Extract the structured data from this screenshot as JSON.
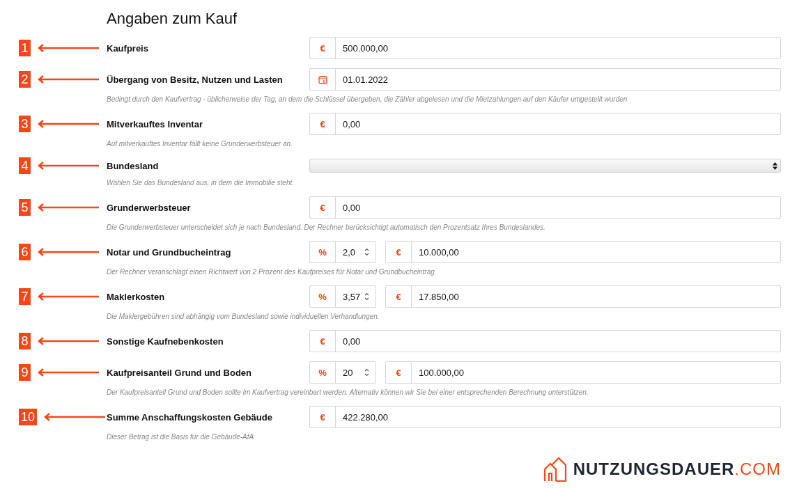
{
  "title": "Angaben zum Kauf",
  "rows": [
    {
      "number": "1",
      "label": "Kaufpreis",
      "kind": "money",
      "prefix": "€",
      "value": "500.000,00"
    },
    {
      "number": "2",
      "label": "Übergang von Besitz, Nutzen und Lasten",
      "kind": "date",
      "value": "01.01.2022",
      "hint": "Bedingt durch den Kaufvertrag - üblicherweise der Tag, an dem die Schlüssel übergeben, die Zähler abgelesen und die Mietzahlungen auf den Käufer umgestellt wurden"
    },
    {
      "number": "3",
      "label": "Mitverkauftes Inventar",
      "kind": "money",
      "prefix": "€",
      "value": "0,00",
      "hint": "Auf mitverkauftes Inventar fällt keine Grunderwerbsteuer an."
    },
    {
      "number": "4",
      "label": "Bundesland",
      "kind": "select",
      "hint": "Wählen Sie das Bundesland aus, in dem die Immobilie steht."
    },
    {
      "number": "5",
      "label": "Grunderwerbsteuer",
      "kind": "money",
      "prefix": "€",
      "value": "0,00",
      "hint": "Die Grunderwerbsteuer unterscheidet sich je nach Bundesland. Der Rechner berücksichtigt automatisch den Prozentsatz Ihres Bundeslandes."
    },
    {
      "number": "6",
      "label": "Notar und Grundbucheintrag",
      "kind": "split",
      "percent_prefix": "%",
      "percent": "2,0",
      "prefix": "€",
      "value": "10.000,00",
      "hint": "Der Rechner veranschlagt einen Richtwert von 2 Prozent des Kaufpreises für Notar und Grundbucheintrag"
    },
    {
      "number": "7",
      "label": "Maklerkosten",
      "kind": "split",
      "percent_prefix": "%",
      "percent": "3,57",
      "prefix": "€",
      "value": "17.850,00",
      "hint": "Die Maklergebühren sind abhängig vom Bundesland sowie individuellen Verhandlungen."
    },
    {
      "number": "8",
      "label": "Sonstige Kaufnebenkosten",
      "kind": "money",
      "prefix": "€",
      "value": "0,00"
    },
    {
      "number": "9",
      "label": "Kaufpreisanteil Grund und Boden",
      "kind": "split",
      "percent_prefix": "%",
      "percent": "20",
      "prefix": "€",
      "value": "100.000,00",
      "hint": "Der Kaufpreisanteil Grund und Boden sollte im Kaufvertrag vereinbart werden. Alternativ können wir Sie bei einer entsprechenden Berechnung unterstützen."
    },
    {
      "number": "10",
      "label": "Summe Anschaffungskosten Gebäude",
      "kind": "money",
      "prefix": "€",
      "value": "422.280,00",
      "hint": "Dieser Betrag ist die Basis für die Gebäude-AfA"
    }
  ],
  "logo": {
    "name": "NUTZUNGSDAUER",
    "suffix": ".COM"
  }
}
